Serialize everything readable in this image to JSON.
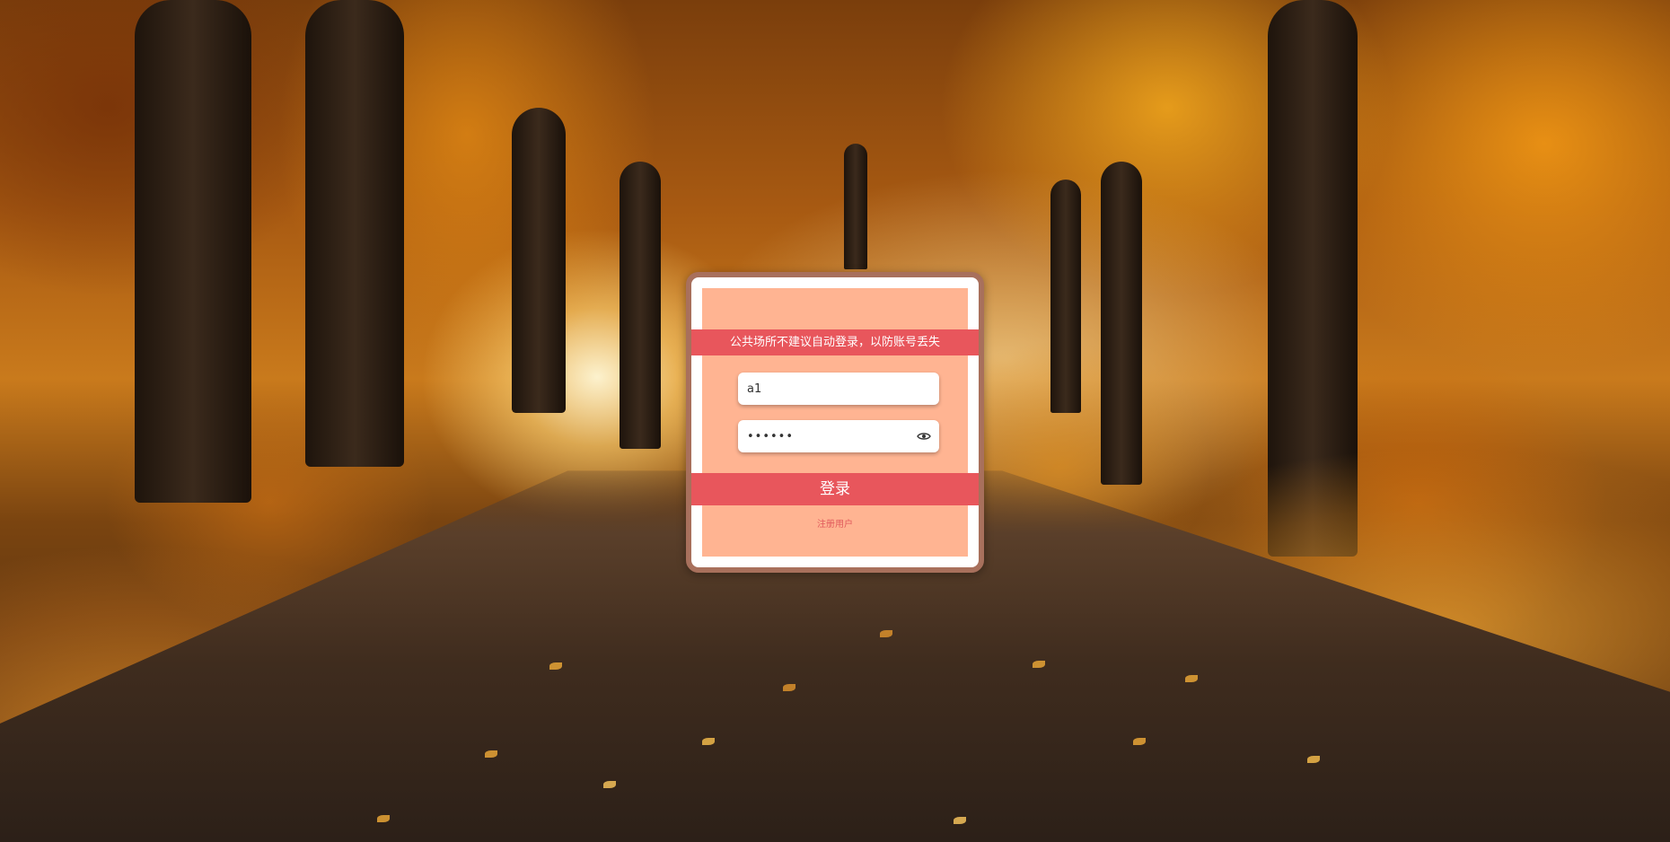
{
  "login": {
    "notice": "公共场所不建议自动登录，以防账号丢失",
    "username_value": "a1",
    "password_value": "123456",
    "login_label": "登录",
    "register_label": "注册用户",
    "show_password_icon": "eye-icon"
  },
  "colors": {
    "accent": "#e8565c",
    "card_fill": "#ffb492",
    "card_border": "#a8705c",
    "register_text": "#e05a5c"
  }
}
